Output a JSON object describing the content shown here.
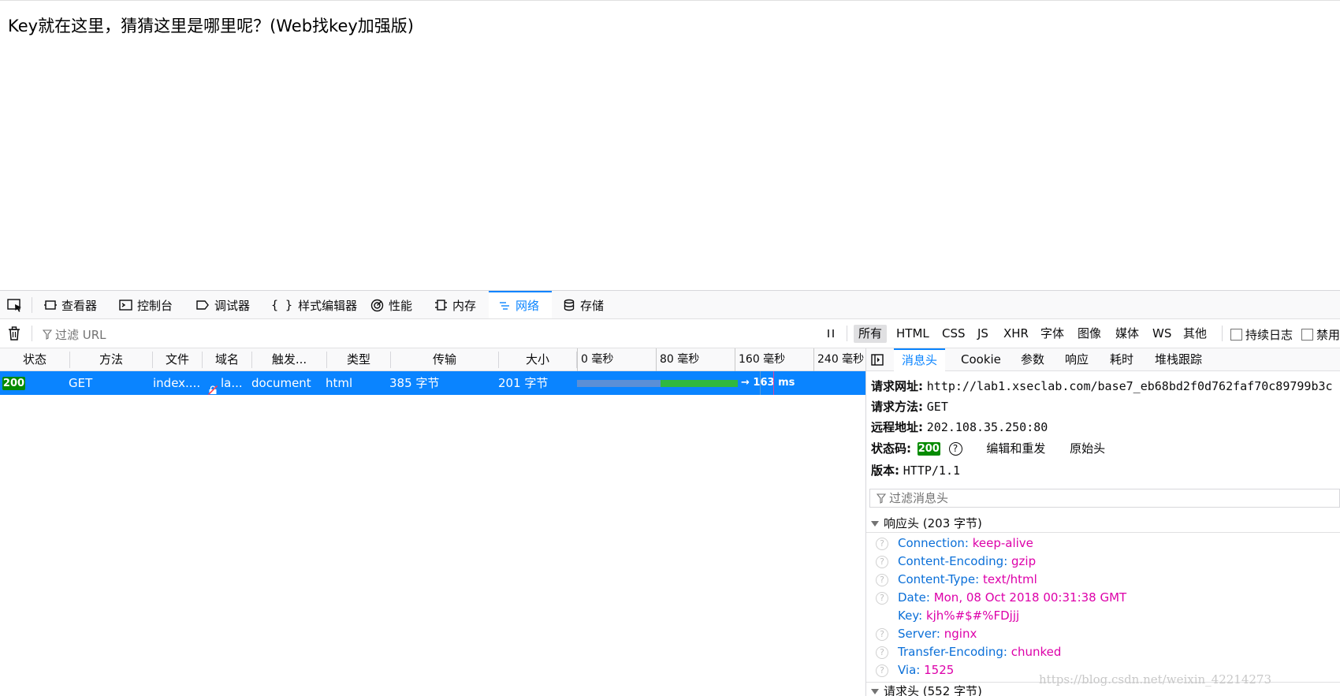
{
  "page": {
    "text": "Key就在这里，猜猜这里是哪里呢？(Web找key加强版)"
  },
  "toolbox": {
    "tabs": [
      {
        "label": "查看器",
        "icon": "inspector-icon"
      },
      {
        "label": "控制台",
        "icon": "console-icon"
      },
      {
        "label": "调试器",
        "icon": "debugger-icon"
      },
      {
        "label": "样式编辑器",
        "icon": "style-editor-icon"
      },
      {
        "label": "性能",
        "icon": "performance-icon"
      },
      {
        "label": "内存",
        "icon": "memory-icon"
      },
      {
        "label": "网络",
        "icon": "network-icon"
      },
      {
        "label": "存储",
        "icon": "storage-icon"
      }
    ],
    "selected_tab": "网络",
    "accent": "#0a84ff"
  },
  "netbar": {
    "filter_placeholder": "过滤 URL",
    "type_filters": [
      "所有",
      "HTML",
      "CSS",
      "JS",
      "XHR",
      "字体",
      "图像",
      "媒体",
      "WS",
      "其他"
    ],
    "active_filter": "所有",
    "persist_label": "持续日志",
    "disable_label": "禁用"
  },
  "columns": [
    "状态",
    "方法",
    "文件",
    "域名",
    "触发...",
    "类型",
    "传输",
    "大小"
  ],
  "timeline_ticks": [
    "0 毫秒",
    "80 毫秒",
    "160 毫秒",
    "240 毫秒"
  ],
  "request": {
    "status": "200",
    "method": "GET",
    "file": "index....",
    "domain": "la...",
    "cause": "document",
    "type": "html",
    "transferred": "385 字节",
    "size": "201 字节",
    "timing": "→ 163 ms",
    "status_color": "#058b00"
  },
  "details": {
    "tabs": [
      "消息头",
      "Cookie",
      "参数",
      "响应",
      "耗时",
      "堆栈跟踪"
    ],
    "selected_tab": "消息头",
    "request_url_label": "请求网址:",
    "request_url": "http://lab1.xseclab.com/base7_eb68bd2f0d762faf70c89799b3c",
    "method_label": "请求方法:",
    "method": "GET",
    "remote_label": "远程地址:",
    "remote": "202.108.35.250:80",
    "status_label": "状态码:",
    "status": "200",
    "edit_resend": "编辑和重发",
    "raw_headers": "原始头",
    "version_label": "版本:",
    "version": "HTTP/1.1",
    "filter_placeholder": "过滤消息头",
    "response_section": "响应头 (203 字节)",
    "response_headers": [
      {
        "name": "Connection:",
        "value": "keep-alive"
      },
      {
        "name": "Content-Encoding:",
        "value": "gzip"
      },
      {
        "name": "Content-Type:",
        "value": "text/html"
      },
      {
        "name": "Date:",
        "value": "Mon, 08 Oct 2018 00:31:38 GMT"
      },
      {
        "name": "Key:",
        "value": "kjh%#$#%FDjjj"
      },
      {
        "name": "Server:",
        "value": "nginx"
      },
      {
        "name": "Transfer-Encoding:",
        "value": "chunked"
      },
      {
        "name": "Via:",
        "value": "1525"
      }
    ],
    "request_section": "请求头 (552 字节)",
    "header_name_color": "#0a6fd8",
    "header_value_color": "#dd00a9"
  },
  "watermark": "https://blog.csdn.net/weixin_42214273"
}
